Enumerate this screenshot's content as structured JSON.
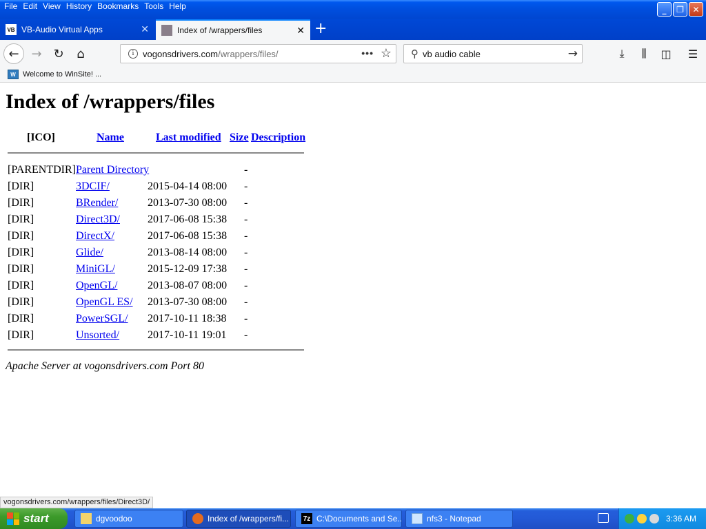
{
  "menu": [
    "File",
    "Edit",
    "View",
    "History",
    "Bookmarks",
    "Tools",
    "Help"
  ],
  "tabs": [
    {
      "title": "VB-Audio Virtual Apps",
      "favicon_text": "VB",
      "active": false
    },
    {
      "title": "Index of /wrappers/files",
      "favicon_text": "",
      "active": true
    }
  ],
  "urlbar": {
    "domain": "vogonsdrivers.com",
    "path": "/wrappers/files/"
  },
  "search": {
    "value": "vb audio cable"
  },
  "bookmarks": [
    {
      "label": "Welcome to WinSite! ..."
    }
  ],
  "page": {
    "title": "Index of /wrappers/files",
    "headers": {
      "icon": "[ICO]",
      "name": "Name",
      "last_modified": "Last modified",
      "size": "Size",
      "description": "Description"
    },
    "rows": [
      {
        "icon": "[PARENTDIR]",
        "name": "Parent Directory",
        "modified": "",
        "size": "-"
      },
      {
        "icon": "[DIR]",
        "name": "3DCIF/",
        "modified": "2015-04-14 08:00",
        "size": "-"
      },
      {
        "icon": "[DIR]",
        "name": "BRender/",
        "modified": "2013-07-30 08:00",
        "size": "-"
      },
      {
        "icon": "[DIR]",
        "name": "Direct3D/",
        "modified": "2017-06-08 15:38",
        "size": "-"
      },
      {
        "icon": "[DIR]",
        "name": "DirectX/",
        "modified": "2017-06-08 15:38",
        "size": "-"
      },
      {
        "icon": "[DIR]",
        "name": "Glide/",
        "modified": "2013-08-14 08:00",
        "size": "-"
      },
      {
        "icon": "[DIR]",
        "name": "MiniGL/",
        "modified": "2015-12-09 17:38",
        "size": "-"
      },
      {
        "icon": "[DIR]",
        "name": "OpenGL/",
        "modified": "2013-08-07 08:00",
        "size": "-"
      },
      {
        "icon": "[DIR]",
        "name": "OpenGL ES/",
        "modified": "2013-07-30 08:00",
        "size": "-"
      },
      {
        "icon": "[DIR]",
        "name": "PowerSGL/",
        "modified": "2017-10-11 18:38",
        "size": "-"
      },
      {
        "icon": "[DIR]",
        "name": "Unsorted/",
        "modified": "2017-10-11 19:01",
        "size": "-"
      }
    ],
    "address": "Apache Server at vogonsdrivers.com Port 80"
  },
  "status_text": "vogonsdrivers.com/wrappers/files/Direct3D/",
  "taskbar": {
    "start_label": "start",
    "tasks": [
      {
        "label": "dgvoodoo",
        "icon": "folder-icon",
        "active": false
      },
      {
        "label": "Index of /wrappers/fi...",
        "icon": "firefox-icon",
        "active": true
      },
      {
        "label": "C:\\Documents and Se...",
        "icon": "7zip-icon",
        "active": false
      },
      {
        "label": "nfs3 - Notepad",
        "icon": "notepad-icon",
        "active": false
      }
    ],
    "clock": "3:36 AM"
  },
  "colors": {
    "link": "#0000ee",
    "taskbar": "#245edb",
    "start": "#3c9a2a",
    "tab_accent": "#0a84ff"
  }
}
